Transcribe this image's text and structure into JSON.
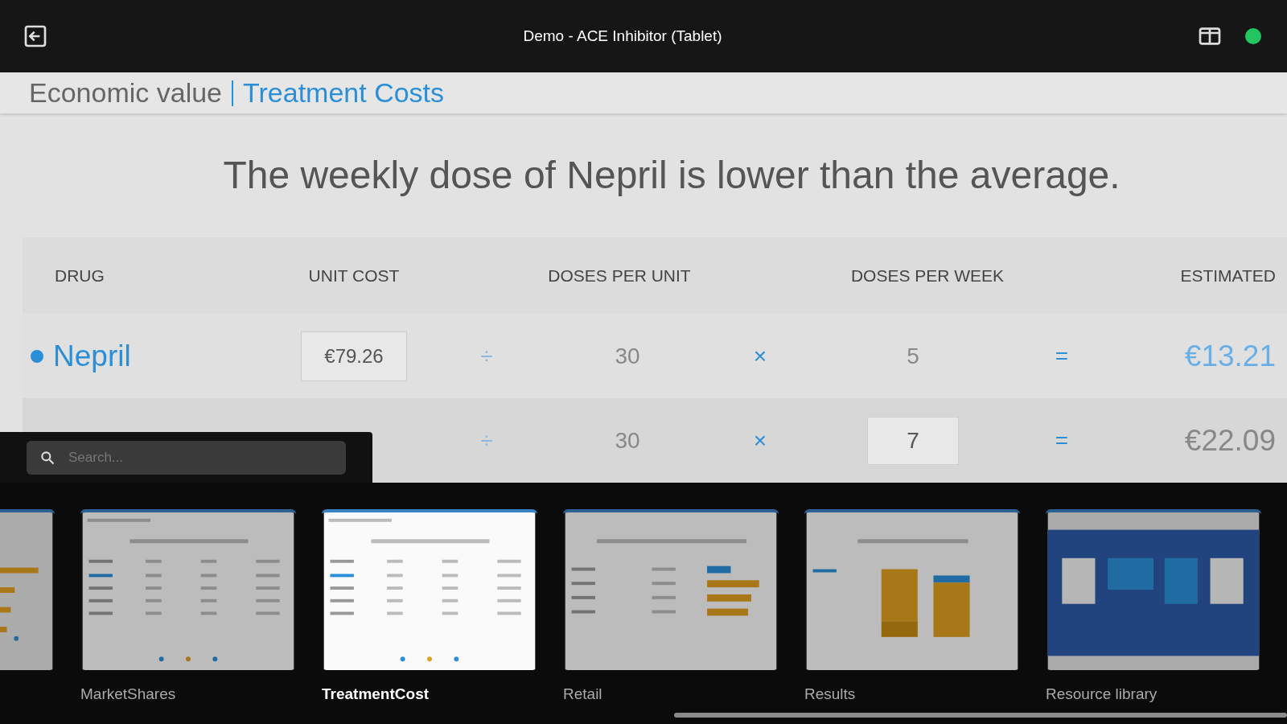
{
  "top_bar": {
    "title": "Demo - ACE Inhibitor (Tablet)"
  },
  "slide": {
    "section": "Economic value",
    "page": "Treatment Costs",
    "headline": "The weekly dose of Nepril is lower than the average.",
    "table": {
      "columns": [
        "DRUG",
        "UNIT COST",
        "DOSES PER UNIT",
        "DOSES PER WEEK",
        "ESTIMATED"
      ],
      "rows": [
        {
          "drug": "Nepril",
          "highlighted": true,
          "unit_cost": "€79.26",
          "op_1": "÷",
          "doses_per_unit": "30",
          "op_2": "×",
          "doses_per_week": "5",
          "week_editable": false,
          "op_3": "=",
          "estimated": "€13.21"
        },
        {
          "highlighted": false,
          "op_1": "÷",
          "doses_per_unit": "30",
          "op_2": "×",
          "doses_per_week": "7",
          "week_editable": true,
          "op_3": "=",
          "estimated": "€22.09"
        }
      ]
    }
  },
  "search": {
    "placeholder": "Search..."
  },
  "thumbnails": [
    {
      "kind": "bars",
      "selected": false
    },
    {
      "kind": "table",
      "label": "MarketShares",
      "selected": false
    },
    {
      "kind": "table",
      "label": "TreatmentCost",
      "selected": true
    },
    {
      "kind": "barlist",
      "label": "Retail",
      "selected": false
    },
    {
      "kind": "stacked",
      "label": "Results",
      "selected": false
    },
    {
      "kind": "library",
      "label": "Resource library",
      "selected": false
    }
  ]
}
